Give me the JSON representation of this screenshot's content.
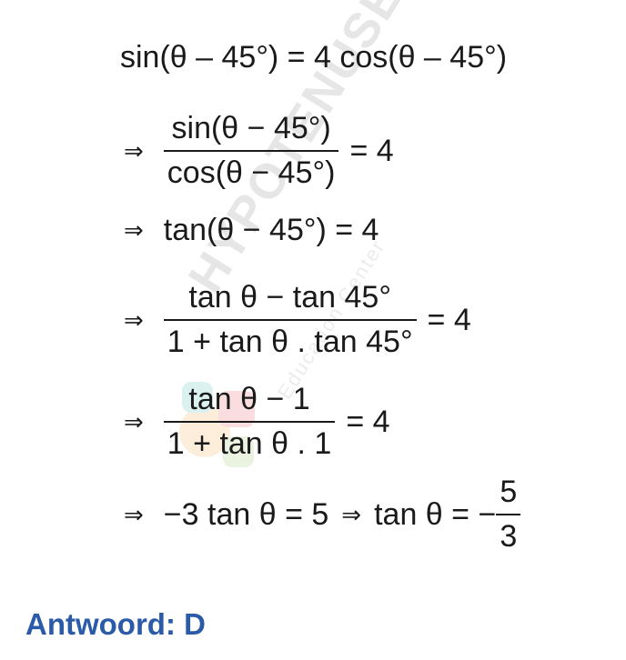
{
  "watermark": {
    "brand": "HYPOTENUSE",
    "subtitle": "Education Center"
  },
  "lines": {
    "l1": {
      "text": "sin(θ – 45°) = 4 cos(θ – 45°)"
    },
    "l2": {
      "arrow": "⇒",
      "num": "sin(θ − 45°)",
      "den": "cos(θ − 45°)",
      "rhs": "= 4"
    },
    "l3": {
      "arrow": "⇒",
      "text": "tan(θ − 45°) = 4"
    },
    "l4": {
      "arrow": "⇒",
      "num": "tan θ − tan 45°",
      "den": "1 + tan θ . tan 45°",
      "rhs": "= 4"
    },
    "l5": {
      "arrow": "⇒",
      "num": "tan θ − 1",
      "den": "1 + tan θ . 1",
      "rhs": "= 4"
    },
    "l6": {
      "arrow": "⇒",
      "left": "−3 tan θ = 5",
      "arrow2": "⇒",
      "mid": "tan θ = −",
      "num": "5",
      "den": "3"
    }
  },
  "answer": "Antwoord: D"
}
